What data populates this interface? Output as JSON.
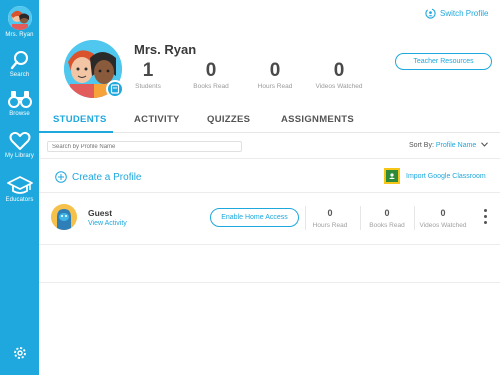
{
  "sidebar": {
    "profile_label": "Mrs. Ryan",
    "items": [
      {
        "label": "Search",
        "icon": "search-icon"
      },
      {
        "label": "Browse",
        "icon": "binoculars-icon"
      },
      {
        "label": "My Library",
        "icon": "heart-icon"
      },
      {
        "label": "Educators",
        "icon": "graduation-cap-icon"
      }
    ],
    "settings_icon": "gear-icon",
    "color": "#1fa8dd"
  },
  "header": {
    "switch_profile": "Switch Profile",
    "teacher_name": "Mrs. Ryan",
    "teacher_resources": "Teacher Resources",
    "stats": [
      {
        "value": "1",
        "label": "Students"
      },
      {
        "value": "0",
        "label": "Books Read"
      },
      {
        "value": "0",
        "label": "Hours Read"
      },
      {
        "value": "0",
        "label": "Videos Watched"
      }
    ]
  },
  "tabs": [
    {
      "label": "STUDENTS",
      "active": true
    },
    {
      "label": "ACTIVITY",
      "active": false
    },
    {
      "label": "QUIZZES",
      "active": false
    },
    {
      "label": "ASSIGNMENTS",
      "active": false
    }
  ],
  "toolbar": {
    "search_placeholder": "Search by Profile Name",
    "sort_label": "Sort By:",
    "sort_value": "Profile Name"
  },
  "actions": {
    "create_profile": "Create a Profile",
    "import_classroom": "Import Google Classroom"
  },
  "students": [
    {
      "name": "Guest",
      "link": "View Activity",
      "home_access": "Enable Home Access",
      "stats": [
        {
          "value": "0",
          "label": "Hours Read"
        },
        {
          "value": "0",
          "label": "Books Read"
        },
        {
          "value": "0",
          "label": "Videos Watched"
        }
      ]
    }
  ]
}
